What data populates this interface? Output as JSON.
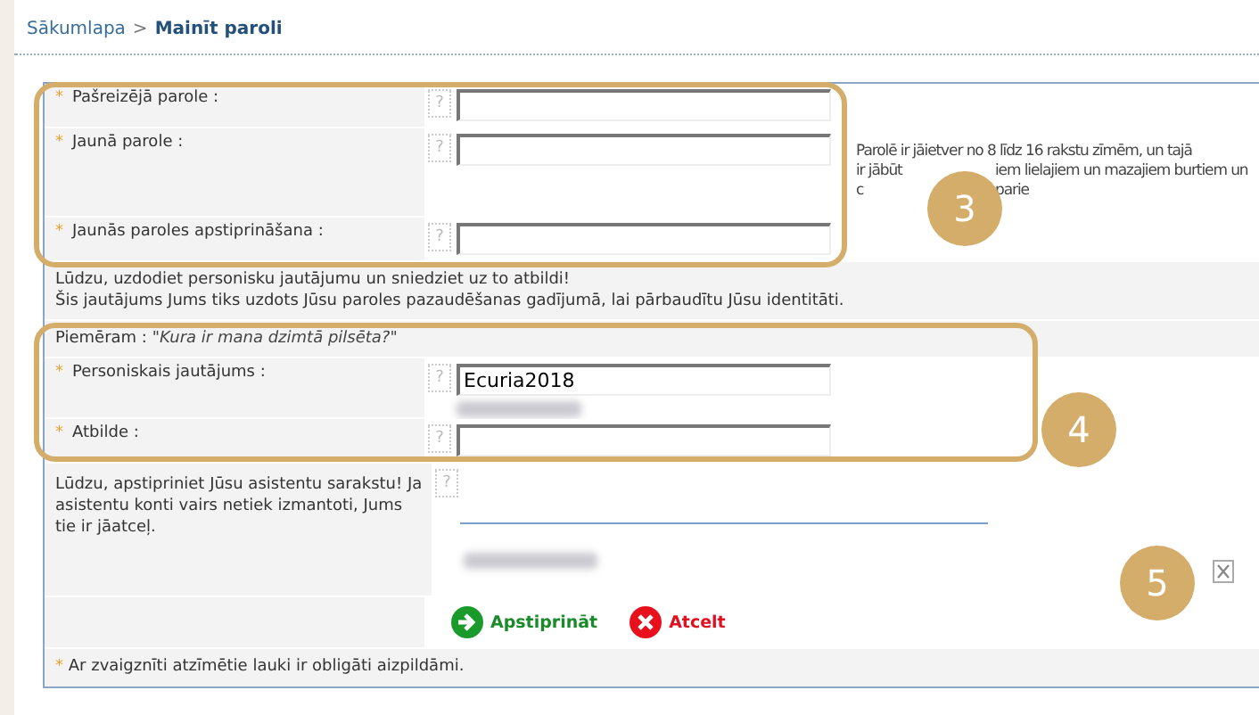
{
  "breadcrumb": {
    "separator": ">",
    "items": [
      {
        "label": "Sākumlapa",
        "selected": false
      },
      {
        "label": "Mainīt paroli",
        "selected": true
      }
    ]
  },
  "required_mark": "*",
  "password_fields": [
    {
      "label": "Pašreizējā parole :",
      "required": true,
      "help": "?"
    },
    {
      "label": "Jaunā parole :",
      "required": true,
      "help": "?"
    },
    {
      "label": "Jaunās paroles apstiprināšana :",
      "required": true,
      "help": "?"
    }
  ],
  "password_hint": [
    [
      "Parolē ir jāietver no 8 līdz 16 rakstu zīmēm, un tajā"
    ],
    [
      "ir jābūt",
      "iem lielajiem un mazajiem burtiem un"
    ],
    [
      "c",
      "parie"
    ]
  ],
  "question_info": [
    "Lūdzu, uzdodiet personisku jautājumu un sniedziet uz to atbildi!",
    "Šis jautājums Jums tiks uzdots Jūsu paroles pazaudēšanas gadījumā, lai pārbaudītu Jūsu identitāti."
  ],
  "example": {
    "label": "Piemēram :",
    "text": "\"Kura ir mana dzimtā pilsēta?\""
  },
  "security_fields": [
    {
      "label": "Personiskais jautājums :",
      "required": true,
      "help": "?",
      "value": "Ecuria2018"
    },
    {
      "label": "Atbilde :",
      "required": true,
      "help": "?"
    }
  ],
  "assistants": {
    "text": "Lūdzu, apstipriniet Jūsu asistentu sarakstu! Ja asistentu konti vairs netiek izmantoti, Jums tie ir jāatceļ.",
    "help": "?"
  },
  "buttons": [
    {
      "label": "Apstiprināt",
      "kind": "confirm"
    },
    {
      "label": "Atcelt",
      "kind": "cancel"
    }
  ],
  "footer": {
    "text": "Ar zvaigznīti atzīmētie lauki ir obligāti aizpildāmi."
  },
  "annotations": [
    {
      "number": "3"
    },
    {
      "number": "4"
    },
    {
      "number": "5"
    }
  ]
}
